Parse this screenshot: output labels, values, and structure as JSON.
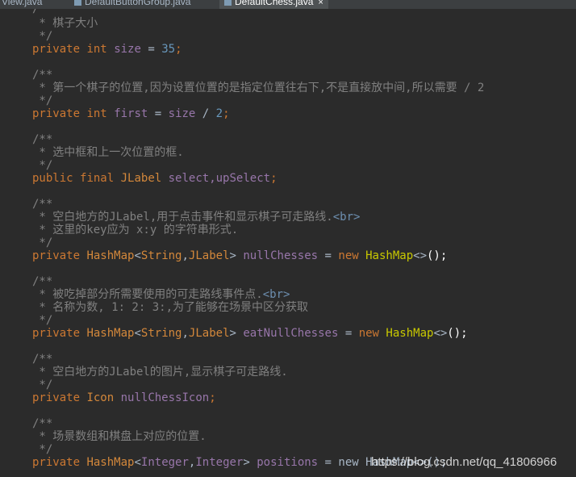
{
  "tabs": [
    {
      "label": "View.java"
    },
    {
      "label": "DefaultButtonGroup.java"
    },
    {
      "label": "DefaultChess.java",
      "close": "×"
    }
  ],
  "code": {
    "l01": "/**",
    "l02": " * 棋子大小",
    "l03": " */",
    "kw_private": "private",
    "kw_public": "public",
    "kw_final": "final",
    "kw_int": "int",
    "kw_new": "new",
    "size_name": "size",
    "eq": " = ",
    "size_value": "35",
    "semi": ";",
    "first_comment": " * 第一个棋子的位置,因为设置位置的是指定位置往右下,不是直接放中间,所以需要 / 2",
    "first_name": "first",
    "div": " / ",
    "two": "2",
    "select_comment": " * 选中框和上一次位置的框.",
    "type_jlabel": "JLabel",
    "select_names": "select,upSelect",
    "null_comment_1": " * 空白地方的JLabel,用于点击事件和显示棋子可走路线.",
    "br_tag": "<br>",
    "null_comment_2": " * 这里的key应为 x:y 的字符串形式.",
    "type_hashmap": "HashMap",
    "type_string": "String",
    "lt": "<",
    "gt": ">",
    "comma": ",",
    "diamond": "<>",
    "call_end": "();",
    "null_chesses": "nullChesses",
    "eat_comment_1": " * 被吃掉部分所需要使用的可走路线事件点.",
    "eat_comment_2": " * 名称为数, 1: 2: 3:,为了能够在场景中区分获取",
    "eat_null_chesses": "eatNullChesses",
    "icon_comment": " * 空白地方的JLabel的图片,显示棋子可走路线.",
    "type_icon": "Icon",
    "icon_name": "nullChessIcon",
    "pos_comment": " * 场景数组和棋盘上对应的位置.",
    "type_integer": "Integer",
    "positions": "positions",
    "last_tail": " = new HashMap<>();"
  },
  "watermark": "https://blog.csdn.net/qq_41806966"
}
